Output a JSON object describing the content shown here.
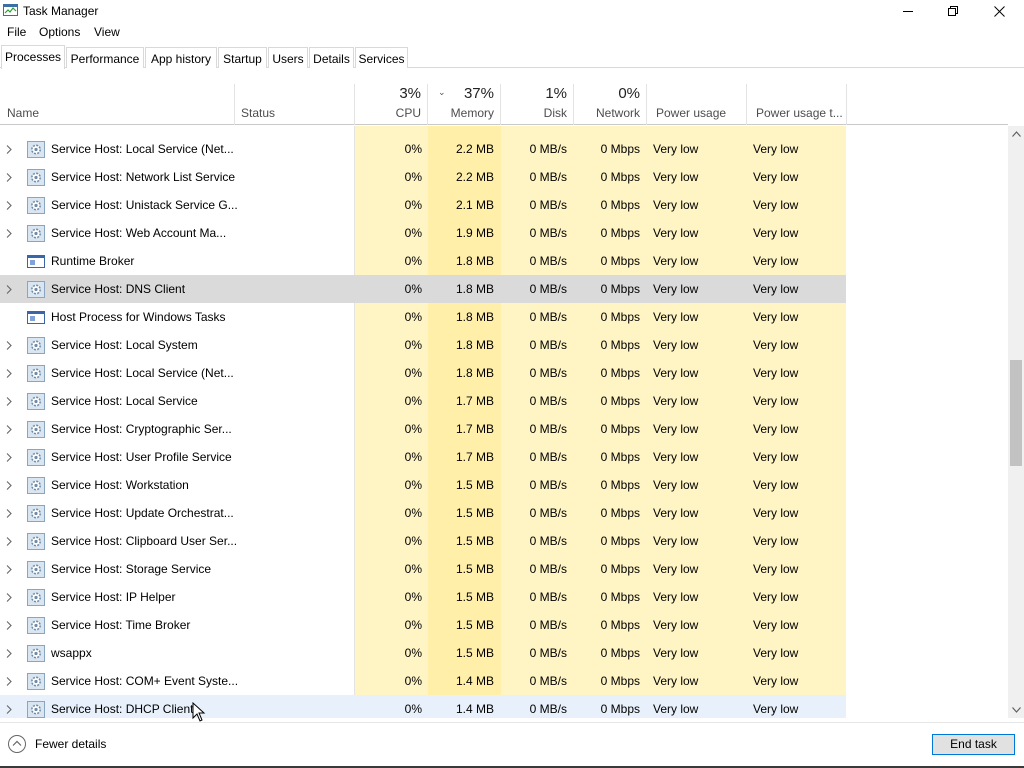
{
  "window": {
    "title": "Task Manager"
  },
  "menu": [
    "File",
    "Options",
    "View"
  ],
  "tabs": [
    "Processes",
    "Performance",
    "App history",
    "Startup",
    "Users",
    "Details",
    "Services"
  ],
  "columns": {
    "name": "Name",
    "status": "Status",
    "cpu": {
      "pct": "3%",
      "label": "CPU"
    },
    "memory": {
      "pct": "37%",
      "label": "Memory"
    },
    "disk": {
      "pct": "1%",
      "label": "Disk"
    },
    "network": {
      "pct": "0%",
      "label": "Network"
    },
    "power": "Power usage",
    "power_trend": "Power usage t..."
  },
  "colors": {
    "heat_light": "#fff4c4",
    "heat_mid": "#ffefa9",
    "selected_row": "#dadada",
    "hover_row": "#e8f1fb",
    "accent": "#0078d7"
  },
  "rows": [
    {
      "name": "Service Host: Local Service (Net...",
      "icon": "gear-icon",
      "expand": true,
      "cpu": "0%",
      "mem": "2.2 MB",
      "disk": "0 MB/s",
      "net": "0 Mbps",
      "power": "Very low",
      "trend": "Very low"
    },
    {
      "name": "Service Host: Network List Service",
      "icon": "gear-icon",
      "expand": true,
      "cpu": "0%",
      "mem": "2.2 MB",
      "disk": "0 MB/s",
      "net": "0 Mbps",
      "power": "Very low",
      "trend": "Very low"
    },
    {
      "name": "Service Host: Unistack Service G...",
      "icon": "gear-icon",
      "expand": true,
      "cpu": "0%",
      "mem": "2.1 MB",
      "disk": "0 MB/s",
      "net": "0 Mbps",
      "power": "Very low",
      "trend": "Very low"
    },
    {
      "name": "Service Host: Web Account Ma...",
      "icon": "gear-icon",
      "expand": true,
      "cpu": "0%",
      "mem": "1.9 MB",
      "disk": "0 MB/s",
      "net": "0 Mbps",
      "power": "Very low",
      "trend": "Very low"
    },
    {
      "name": "Runtime Broker",
      "icon": "window-icon",
      "expand": false,
      "cpu": "0%",
      "mem": "1.8 MB",
      "disk": "0 MB/s",
      "net": "0 Mbps",
      "power": "Very low",
      "trend": "Very low"
    },
    {
      "name": "Service Host: DNS Client",
      "icon": "gear-icon",
      "expand": true,
      "cpu": "0%",
      "mem": "1.8 MB",
      "disk": "0 MB/s",
      "net": "0 Mbps",
      "power": "Very low",
      "trend": "Very low",
      "state": "selected"
    },
    {
      "name": "Host Process for Windows Tasks",
      "icon": "window-icon",
      "expand": false,
      "cpu": "0%",
      "mem": "1.8 MB",
      "disk": "0 MB/s",
      "net": "0 Mbps",
      "power": "Very low",
      "trend": "Very low"
    },
    {
      "name": "Service Host: Local System",
      "icon": "gear-icon",
      "expand": true,
      "cpu": "0%",
      "mem": "1.8 MB",
      "disk": "0 MB/s",
      "net": "0 Mbps",
      "power": "Very low",
      "trend": "Very low"
    },
    {
      "name": "Service Host: Local Service (Net...",
      "icon": "gear-icon",
      "expand": true,
      "cpu": "0%",
      "mem": "1.8 MB",
      "disk": "0 MB/s",
      "net": "0 Mbps",
      "power": "Very low",
      "trend": "Very low"
    },
    {
      "name": "Service Host: Local Service",
      "icon": "gear-icon",
      "expand": true,
      "cpu": "0%",
      "mem": "1.7 MB",
      "disk": "0 MB/s",
      "net": "0 Mbps",
      "power": "Very low",
      "trend": "Very low"
    },
    {
      "name": "Service Host: Cryptographic Ser...",
      "icon": "gear-icon",
      "expand": true,
      "cpu": "0%",
      "mem": "1.7 MB",
      "disk": "0 MB/s",
      "net": "0 Mbps",
      "power": "Very low",
      "trend": "Very low"
    },
    {
      "name": "Service Host: User Profile Service",
      "icon": "gear-icon",
      "expand": true,
      "cpu": "0%",
      "mem": "1.7 MB",
      "disk": "0 MB/s",
      "net": "0 Mbps",
      "power": "Very low",
      "trend": "Very low"
    },
    {
      "name": "Service Host: Workstation",
      "icon": "gear-icon",
      "expand": true,
      "cpu": "0%",
      "mem": "1.5 MB",
      "disk": "0 MB/s",
      "net": "0 Mbps",
      "power": "Very low",
      "trend": "Very low"
    },
    {
      "name": "Service Host: Update Orchestrat...",
      "icon": "gear-icon",
      "expand": true,
      "cpu": "0%",
      "mem": "1.5 MB",
      "disk": "0 MB/s",
      "net": "0 Mbps",
      "power": "Very low",
      "trend": "Very low"
    },
    {
      "name": "Service Host: Clipboard User Ser...",
      "icon": "gear-icon",
      "expand": true,
      "cpu": "0%",
      "mem": "1.5 MB",
      "disk": "0 MB/s",
      "net": "0 Mbps",
      "power": "Very low",
      "trend": "Very low"
    },
    {
      "name": "Service Host: Storage Service",
      "icon": "gear-icon",
      "expand": true,
      "cpu": "0%",
      "mem": "1.5 MB",
      "disk": "0 MB/s",
      "net": "0 Mbps",
      "power": "Very low",
      "trend": "Very low"
    },
    {
      "name": "Service Host: IP Helper",
      "icon": "gear-icon",
      "expand": true,
      "cpu": "0%",
      "mem": "1.5 MB",
      "disk": "0 MB/s",
      "net": "0 Mbps",
      "power": "Very low",
      "trend": "Very low"
    },
    {
      "name": "Service Host: Time Broker",
      "icon": "gear-icon",
      "expand": true,
      "cpu": "0%",
      "mem": "1.5 MB",
      "disk": "0 MB/s",
      "net": "0 Mbps",
      "power": "Very low",
      "trend": "Very low"
    },
    {
      "name": "wsappx",
      "icon": "gear-icon",
      "expand": true,
      "cpu": "0%",
      "mem": "1.5 MB",
      "disk": "0 MB/s",
      "net": "0 Mbps",
      "power": "Very low",
      "trend": "Very low"
    },
    {
      "name": "Service Host: COM+ Event Syste...",
      "icon": "gear-icon",
      "expand": true,
      "cpu": "0%",
      "mem": "1.4 MB",
      "disk": "0 MB/s",
      "net": "0 Mbps",
      "power": "Very low",
      "trend": "Very low"
    },
    {
      "name": "Service Host: DHCP Client",
      "icon": "gear-icon",
      "expand": true,
      "cpu": "0%",
      "mem": "1.4 MB",
      "disk": "0 MB/s",
      "net": "0 Mbps",
      "power": "Very low",
      "trend": "Very low",
      "state": "hover"
    }
  ],
  "footer": {
    "fewer_details": "Fewer details",
    "end_task": "End task"
  }
}
